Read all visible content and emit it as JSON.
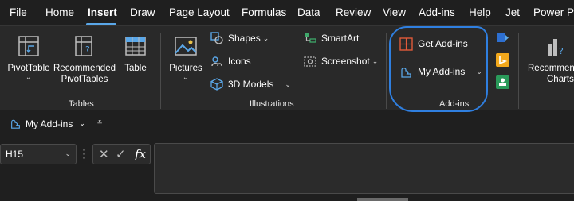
{
  "menu": {
    "items": [
      {
        "label": "File"
      },
      {
        "label": "Home"
      },
      {
        "label": "Insert"
      },
      {
        "label": "Draw"
      },
      {
        "label": "Page Layout"
      },
      {
        "label": "Formulas"
      },
      {
        "label": "Data"
      },
      {
        "label": "Review"
      },
      {
        "label": "View"
      },
      {
        "label": "Add-ins"
      },
      {
        "label": "Help"
      },
      {
        "label": "Jet"
      },
      {
        "label": "Power Pi"
      }
    ],
    "active": "Insert"
  },
  "ribbon": {
    "tables": {
      "label": "Tables",
      "pivottable": "PivotTable",
      "recommended_line1": "Recommended",
      "recommended_line2": "PivotTables",
      "table": "Table"
    },
    "illustrations": {
      "label": "Illustrations",
      "pictures": "Pictures",
      "shapes": "Shapes",
      "icons": "Icons",
      "models": "3D Models",
      "smartart": "SmartArt",
      "screenshot": "Screenshot"
    },
    "addins": {
      "label": "Add-ins",
      "get": "Get Add-ins",
      "my": "My Add-ins"
    },
    "charts": {
      "line1": "Recommen",
      "line2": "Charts"
    }
  },
  "qat": {
    "my_addins": "My Add-ins"
  },
  "formula_bar": {
    "namebox": "H15",
    "fx": "fx",
    "formula": ""
  },
  "colors": {
    "background": "#1f1f1f",
    "ribbon": "#292929",
    "accent_underline": "#5aa7e8",
    "annotation_circle": "#2f7fe0"
  }
}
